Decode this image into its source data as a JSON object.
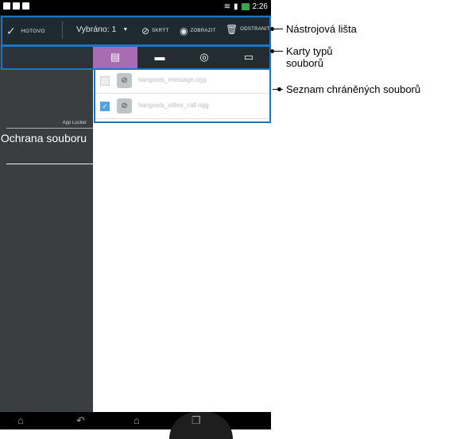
{
  "status_bar": {
    "time": "2:26"
  },
  "toolbar": {
    "done_label": "HOTOVO",
    "selected_label": "Vybráno: 1",
    "hide_label": "SKRÝT",
    "show_label": "ZOBRAZIT",
    "delete_label": "ODSTRANIT"
  },
  "tabs": [
    {
      "icon": "document-icon",
      "active": true
    },
    {
      "icon": "image-icon",
      "active": false
    },
    {
      "icon": "music-icon",
      "active": false
    },
    {
      "icon": "clipboard-icon",
      "active": false
    }
  ],
  "left_pane": {
    "app_label": "App Locker",
    "title": "Ochrana souboru"
  },
  "files": [
    {
      "name": "hangouts_message.ogg",
      "checked": false
    },
    {
      "name": "hangouts_video_call.ogg",
      "checked": true
    }
  ],
  "annotations": {
    "toolbar": "Nástrojová lišta",
    "tabs": "Karty typů souborů",
    "list": "Seznam chráněných souborů"
  },
  "colors": {
    "toolbar_bg": "#1f2a30",
    "active_tab": "#a96bb2",
    "left_pane": "#3a3e40",
    "highlight_box": "#1877c9"
  }
}
